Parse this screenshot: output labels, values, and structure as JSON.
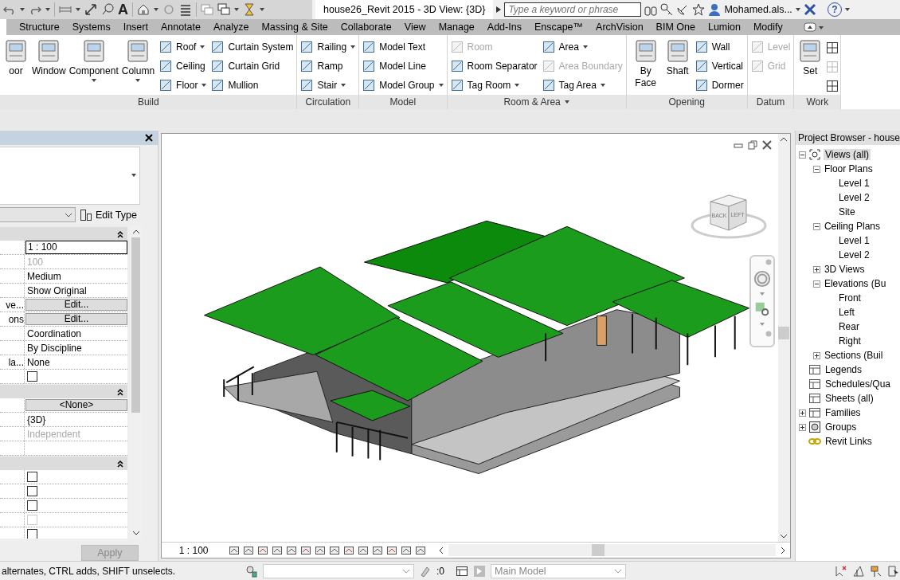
{
  "quick_access": {
    "text_icon": "A"
  },
  "title": "house26_Revit 2015 - 3D View: {3D}",
  "search": {
    "placeholder": "Type a keyword or phrase"
  },
  "user": "Mohamed.als...",
  "help": "?",
  "tabs": [
    {
      "label": "Structure",
      "selected": false
    },
    {
      "label": "Systems",
      "selected": false
    },
    {
      "label": "Insert",
      "selected": false
    },
    {
      "label": "Annotate",
      "selected": false
    },
    {
      "label": "Analyze",
      "selected": false
    },
    {
      "label": "Massing & Site",
      "selected": false
    },
    {
      "label": "Collaborate",
      "selected": false
    },
    {
      "label": "View",
      "selected": false
    },
    {
      "label": "Manage",
      "selected": false
    },
    {
      "label": "Add-Ins",
      "selected": false
    },
    {
      "label": "Enscape™",
      "selected": false
    },
    {
      "label": "ArchVision",
      "selected": false
    },
    {
      "label": "BIM One",
      "selected": false
    },
    {
      "label": "Lumion",
      "selected": false
    },
    {
      "label": "Modify",
      "selected": false
    }
  ],
  "ribbon": [
    {
      "title": "Build",
      "menu": false,
      "groups": [
        {
          "kind": "large",
          "items": [
            {
              "label": "oor",
              "menu": false,
              "disabled": false
            },
            {
              "label": "Window",
              "menu": false,
              "disabled": false
            },
            {
              "label": "Component",
              "menu": true,
              "disabled": false
            },
            {
              "label": "Column",
              "menu": true,
              "disabled": false
            }
          ]
        },
        {
          "kind": "column",
          "items": [
            {
              "label": "Roof",
              "menu": true,
              "disabled": false
            },
            {
              "label": "Ceiling",
              "menu": false,
              "disabled": false
            },
            {
              "label": "Floor",
              "menu": true,
              "disabled": false
            }
          ]
        },
        {
          "kind": "column",
          "items": [
            {
              "label": "Curtain System",
              "menu": false,
              "disabled": false
            },
            {
              "label": "Curtain Grid",
              "menu": false,
              "disabled": false
            },
            {
              "label": "Mullion",
              "menu": false,
              "disabled": false
            }
          ]
        }
      ]
    },
    {
      "title": "Circulation",
      "menu": false,
      "groups": [
        {
          "kind": "column",
          "items": [
            {
              "label": "Railing",
              "menu": true,
              "disabled": false
            },
            {
              "label": "Ramp",
              "menu": false,
              "disabled": false
            },
            {
              "label": "Stair",
              "menu": true,
              "disabled": false
            }
          ]
        }
      ]
    },
    {
      "title": "Model",
      "menu": false,
      "groups": [
        {
          "kind": "column",
          "items": [
            {
              "label": "Model Text",
              "menu": false,
              "disabled": false
            },
            {
              "label": "Model Line",
              "menu": false,
              "disabled": false
            },
            {
              "label": "Model Group",
              "menu": true,
              "disabled": false
            }
          ]
        }
      ]
    },
    {
      "title": "Room & Area",
      "menu": true,
      "groups": [
        {
          "kind": "column",
          "items": [
            {
              "label": "Room",
              "menu": false,
              "disabled": true
            },
            {
              "label": "Room Separator",
              "menu": false,
              "disabled": false
            },
            {
              "label": "Tag Room",
              "menu": true,
              "disabled": false
            }
          ]
        },
        {
          "kind": "column",
          "items": [
            {
              "label": "Area",
              "menu": true,
              "disabled": false
            },
            {
              "label": "Area Boundary",
              "menu": false,
              "disabled": true
            },
            {
              "label": "Tag Area",
              "menu": true,
              "disabled": false
            }
          ]
        }
      ]
    },
    {
      "title": "Opening",
      "menu": false,
      "groups": [
        {
          "kind": "large",
          "items": [
            {
              "label": "By Face",
              "menu": false,
              "disabled": false
            },
            {
              "label": "Shaft",
              "menu": false,
              "disabled": false
            }
          ]
        },
        {
          "kind": "column",
          "items": [
            {
              "label": "Wall",
              "menu": false,
              "disabled": false
            },
            {
              "label": "Vertical",
              "menu": false,
              "disabled": false
            },
            {
              "label": "Dormer",
              "menu": false,
              "disabled": false
            }
          ]
        }
      ]
    },
    {
      "title": "Datum",
      "menu": false,
      "groups": [
        {
          "kind": "column",
          "items": [
            {
              "label": "Level",
              "menu": false,
              "disabled": true
            },
            {
              "label": "Grid",
              "menu": false,
              "disabled": true
            }
          ]
        }
      ]
    },
    {
      "title": "Work",
      "menu": false,
      "groups": [
        {
          "kind": "large",
          "items": [
            {
              "label": "Set",
              "menu": false,
              "disabled": false
            }
          ]
        },
        {
          "kind": "icons",
          "items": [
            {
              "disabled": false
            },
            {
              "disabled": true
            },
            {
              "disabled": false
            }
          ]
        }
      ]
    }
  ],
  "properties": {
    "edit_type": "Edit Type",
    "sections": [
      {
        "expanded": true,
        "rows": [
          {
            "kind": "field",
            "value": "1 : 100",
            "disabled": false
          },
          {
            "kind": "text",
            "value": "100",
            "disabled": true
          },
          {
            "kind": "text",
            "value": "Medium",
            "disabled": false
          },
          {
            "kind": "text",
            "value": "Show Original",
            "disabled": false
          },
          {
            "kind": "button",
            "label": "ve...",
            "value": "Edit...",
            "disabled": false
          },
          {
            "kind": "button",
            "label": "ons",
            "value": "Edit...",
            "disabled": false
          },
          {
            "kind": "text",
            "value": "Coordination",
            "disabled": false
          },
          {
            "kind": "text",
            "value": "By Discipline",
            "disabled": false
          },
          {
            "kind": "text",
            "label": "la...",
            "value": "None",
            "disabled": false
          },
          {
            "kind": "checkbox",
            "checked": false,
            "disabled": false
          }
        ]
      },
      {
        "expanded": true,
        "rows": [
          {
            "kind": "button",
            "value": "<None>",
            "disabled": false
          },
          {
            "kind": "text",
            "value": "{3D}",
            "disabled": false
          },
          {
            "kind": "text",
            "value": "Independent",
            "disabled": true
          },
          {
            "kind": "empty",
            "disabled": false
          }
        ]
      },
      {
        "expanded": true,
        "rows": [
          {
            "kind": "checkbox",
            "checked": false,
            "disabled": false
          },
          {
            "kind": "checkbox",
            "checked": false,
            "disabled": false
          },
          {
            "kind": "checkbox",
            "checked": false,
            "disabled": false
          },
          {
            "kind": "checkbox",
            "checked": false,
            "disabled": true
          },
          {
            "kind": "checkbox",
            "checked": false,
            "disabled": false
          }
        ]
      }
    ],
    "apply": {
      "label": "Apply",
      "disabled": true
    }
  },
  "view": {
    "scale": "1 : 100",
    "view_cube": [
      "BACK",
      "LEFT"
    ]
  },
  "browser": {
    "title": "Project Browser - house",
    "tree": [
      {
        "label": "Views (all)",
        "kind": "views",
        "expanded": true,
        "selected": true,
        "children": [
          {
            "label": "Floor Plans",
            "expanded": true,
            "selected": false,
            "children": [
              {
                "label": "Level 1",
                "selected": false
              },
              {
                "label": "Level 2",
                "selected": false
              },
              {
                "label": "Site",
                "selected": false
              }
            ]
          },
          {
            "label": "Ceiling Plans",
            "expanded": true,
            "selected": false,
            "children": [
              {
                "label": "Level 1",
                "selected": false
              },
              {
                "label": "Level 2",
                "selected": false
              }
            ]
          },
          {
            "label": "3D Views",
            "expanded": false,
            "selected": false
          },
          {
            "label": "Elevations (Bu",
            "expanded": true,
            "selected": false,
            "children": [
              {
                "label": "Front",
                "selected": false
              },
              {
                "label": "Left",
                "selected": false
              },
              {
                "label": "Rear",
                "selected": false
              },
              {
                "label": "Right",
                "selected": false
              }
            ]
          },
          {
            "label": "Sections (Buil",
            "expanded": false,
            "selected": false
          }
        ]
      },
      {
        "label": "Legends",
        "kind": "legends",
        "selected": false
      },
      {
        "label": "Schedules/Qua",
        "kind": "schedules",
        "selected": false
      },
      {
        "label": "Sheets (all)",
        "kind": "sheets",
        "selected": false
      },
      {
        "label": "Families",
        "kind": "families",
        "expanded": false,
        "selected": false
      },
      {
        "label": "Groups",
        "kind": "groups",
        "expanded": false,
        "selected": false
      },
      {
        "label": "Revit Links",
        "kind": "links",
        "selected": false
      }
    ]
  },
  "status": {
    "hint": "alternates, CTRL adds, SHIFT unselects.",
    "count": ":0",
    "model": "Main Model"
  }
}
